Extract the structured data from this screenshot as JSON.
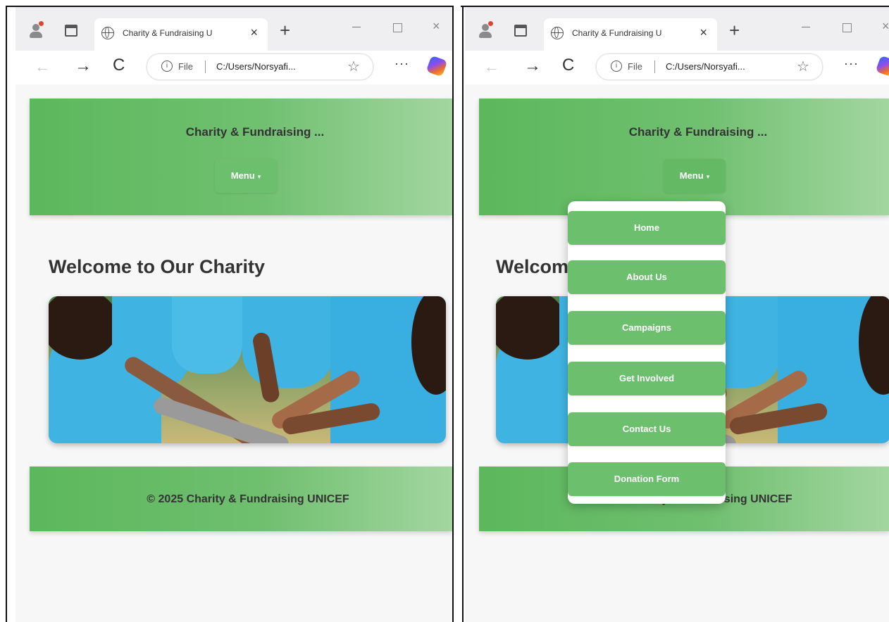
{
  "browser": {
    "tab_title": "Charity & Fundraising U",
    "tab_close": "×",
    "new_tab": "+",
    "minimize": "—",
    "close": "×",
    "back": "←",
    "forward": "→",
    "reload": "C",
    "file_label": "File",
    "url": "C:/Users/Norsyafi...",
    "favorite": "☆",
    "more": "···"
  },
  "site": {
    "title": "Charity & Fundraising ...",
    "menu_label": "Menu",
    "menu_caret": "▾",
    "welcome": "Welcome to Our Charity",
    "welcome_partial": "Welcome to Our Charity",
    "footer": "© 2025 Charity & Fundraising UNICEF"
  },
  "dropdown": {
    "items": [
      {
        "label": "Home"
      },
      {
        "label": "About Us"
      },
      {
        "label": "Campaigns"
      },
      {
        "label": "Get Involved"
      },
      {
        "label": "Contact Us"
      },
      {
        "label": "Donation Form"
      }
    ]
  },
  "colors": {
    "header_green": "#5cb85c",
    "menu_green": "#6cbf6c",
    "shirt_blue": "#3fb4e2"
  }
}
